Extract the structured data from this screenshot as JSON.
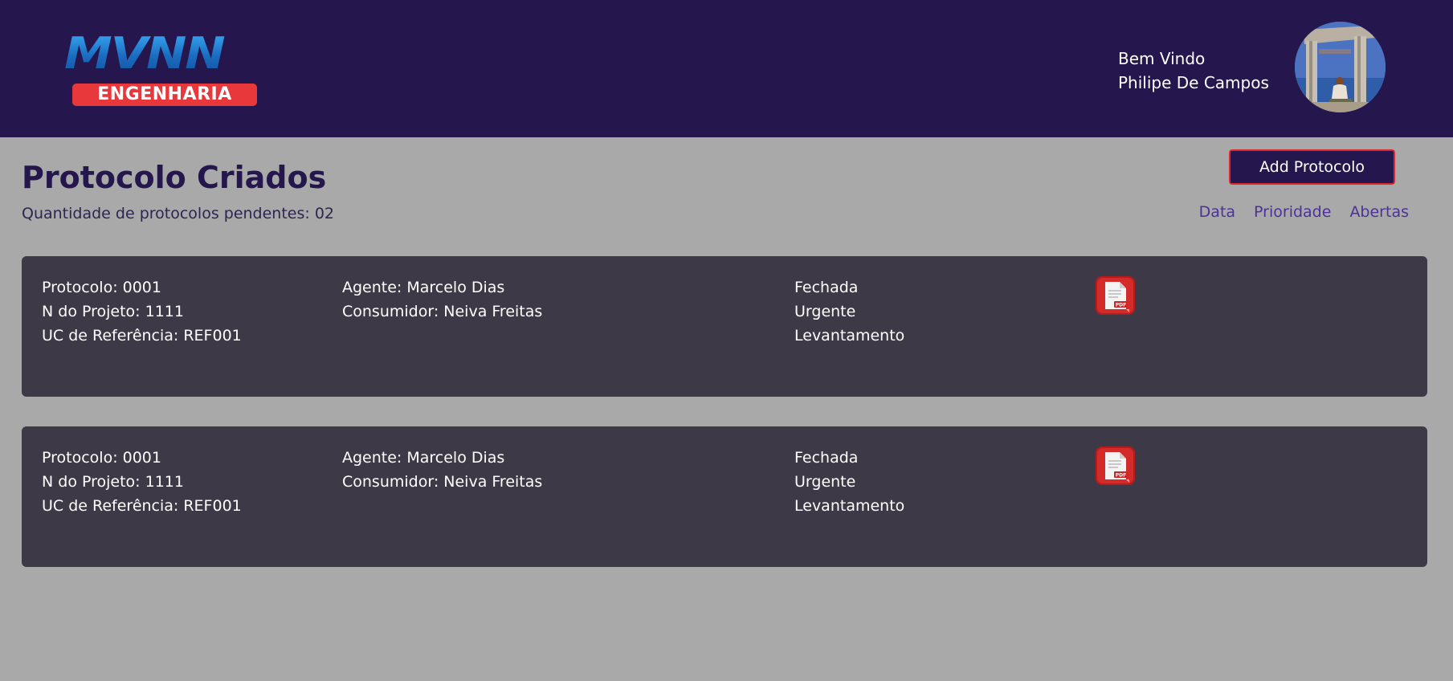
{
  "header": {
    "logo_top": "MVNN",
    "logo_bottom": "ENGENHARIA",
    "welcome_label": "Bem Vindo",
    "user_name": "Philipe De Campos"
  },
  "main": {
    "title": "Protocolo Criados",
    "pending_text": "Quantidade de protocolos pendentes: 02",
    "add_button_label": "Add Protocolo",
    "filters": [
      "Data",
      "Prioridade",
      "Abertas"
    ]
  },
  "protocols": [
    {
      "protocolo": "Protocolo: 0001",
      "projeto": "N do Projeto: 1111",
      "uc": "UC de Referência: REF001",
      "agente": "Agente: Marcelo Dias",
      "consumidor": "Consumidor: Neiva Freitas",
      "status": "Fechada",
      "prioridade": "Urgente",
      "tipo": "Levantamento",
      "icon": "pdf-icon",
      "pdf_badge": "PDF"
    },
    {
      "protocolo": "Protocolo: 0001",
      "projeto": "N do Projeto: 1111",
      "uc": "UC de Referência: REF001",
      "agente": "Agente: Marcelo Dias",
      "consumidor": "Consumidor: Neiva Freitas",
      "status": "Fechada",
      "prioridade": "Urgente",
      "tipo": "Levantamento",
      "icon": "pdf-icon",
      "pdf_badge": "PDF"
    }
  ],
  "colors": {
    "header_bg": "#25174d",
    "page_bg": "#a9a9a9",
    "card_bg": "#3e3946",
    "accent_red": "#e0262e",
    "filter_link": "#4d3199"
  }
}
